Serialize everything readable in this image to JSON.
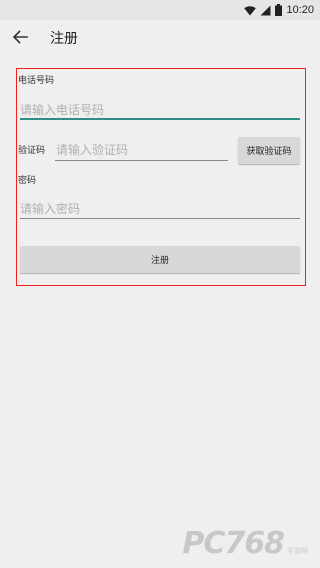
{
  "status_bar": {
    "time": "10:20",
    "icons": [
      "wifi-icon",
      "signal-icon",
      "battery-icon"
    ]
  },
  "app_bar": {
    "back_icon": "arrow-left-icon",
    "title": "注册"
  },
  "form": {
    "phone": {
      "label": "电话号码",
      "value": "",
      "placeholder": "请输入电话号码"
    },
    "code": {
      "label": "验证码",
      "value": "",
      "placeholder": "请输入验证码",
      "button_label": "获取验证码"
    },
    "password": {
      "label": "密码",
      "value": "",
      "placeholder": "请输入密码"
    },
    "submit_label": "注册"
  },
  "watermark": {
    "brand": "PC768",
    "sub": "手游网"
  },
  "colors": {
    "background": "#efefef",
    "accent": "#2f8f86",
    "highlight_border": "#ee2020",
    "button": "#d8d8d8"
  }
}
